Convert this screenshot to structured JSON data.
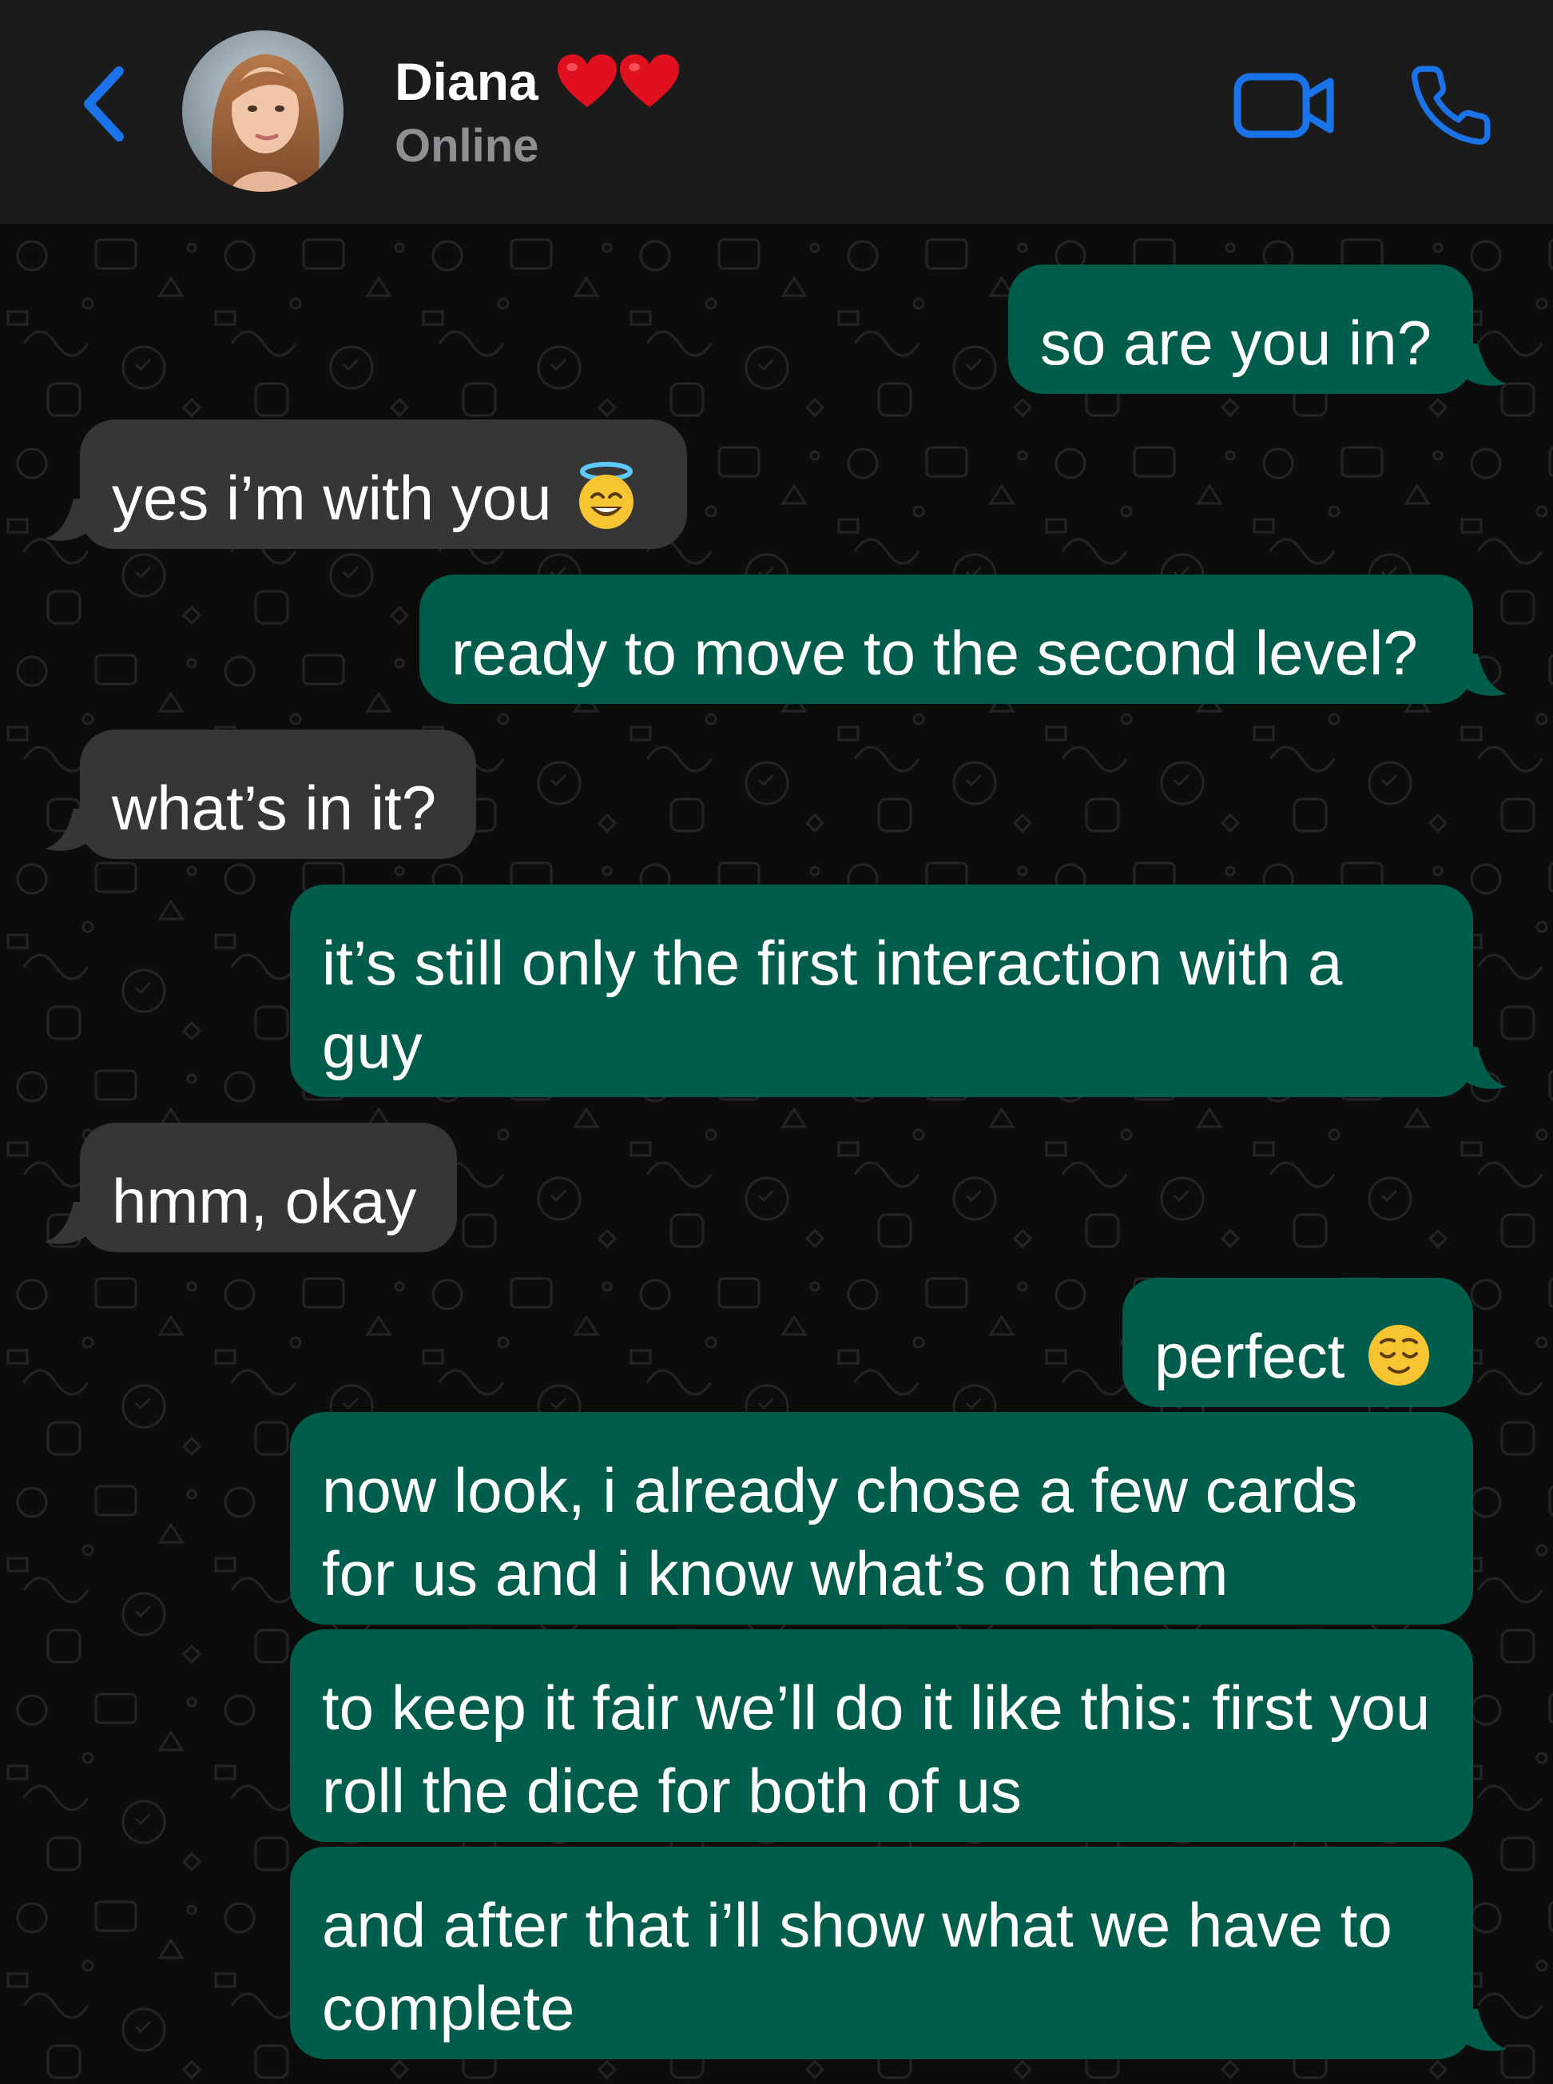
{
  "header": {
    "contact_name": "Diana",
    "status": "Online",
    "icons": [
      "chevron-left-icon",
      "avatar",
      "heart-icon",
      "heart-icon",
      "video-camera-icon",
      "phone-icon"
    ],
    "accent_color": "#1a73e8"
  },
  "messages": [
    {
      "direction": "out",
      "text": "so are you in?"
    },
    {
      "direction": "in",
      "text": "yes i’m with you",
      "emoji": "smiling-face-with-halo"
    },
    {
      "direction": "out",
      "text": "ready to move to the second level?"
    },
    {
      "direction": "in",
      "text": "what’s in it?"
    },
    {
      "direction": "out",
      "text": "it’s still only the first interaction with a guy"
    },
    {
      "direction": "in",
      "text": "hmm, okay"
    },
    {
      "direction": "out",
      "text": "perfect",
      "emoji": "relieved-face"
    },
    {
      "direction": "out",
      "text": "now look, i already chose a few cards for us and i know what’s on them"
    },
    {
      "direction": "out",
      "text": "to keep it fair we’ll do it like this: first you roll the dice for both of us"
    },
    {
      "direction": "out",
      "text": "and after that i’ll show what we have to complete"
    }
  ],
  "colors": {
    "outgoing_bubble": "#005c4b",
    "incoming_bubble": "#363636",
    "header_bg": "#1b1b1b",
    "chat_bg": "#0c0c0c"
  }
}
